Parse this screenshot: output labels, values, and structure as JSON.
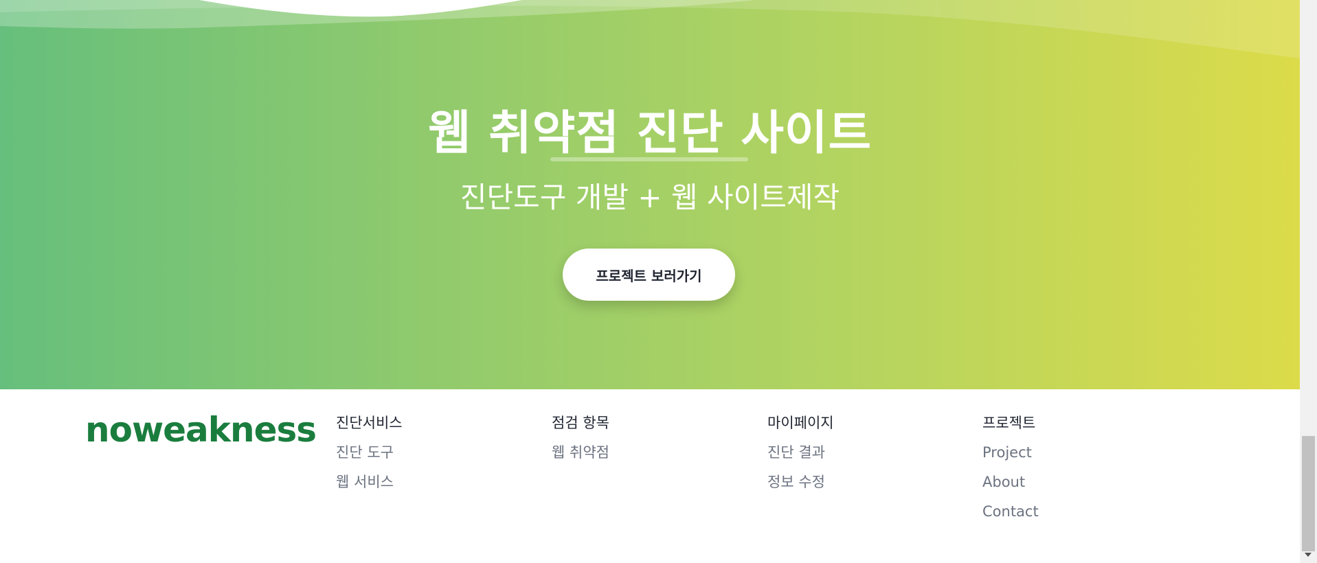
{
  "hero": {
    "title": "웹 취약점 진단 사이트",
    "subtitle": "진단도구 개발 + 웹 사이트제작",
    "button_label": "프로젝트 보러가기"
  },
  "footer": {
    "brand": "noweakness",
    "columns": [
      {
        "heading": "진단서비스",
        "links": [
          "진단 도구",
          "웹 서비스"
        ]
      },
      {
        "heading": "점검 항목",
        "links": [
          "웹 취약점"
        ]
      },
      {
        "heading": "마이페이지",
        "links": [
          "진단 결과",
          "정보 수정"
        ]
      },
      {
        "heading": "프로젝트",
        "links": [
          "Project",
          "About",
          "Contact"
        ]
      }
    ]
  },
  "colors": {
    "gradient_start": "#66bf7c",
    "gradient_end": "#dcdb4a",
    "brand_green": "#1a7d3e"
  }
}
